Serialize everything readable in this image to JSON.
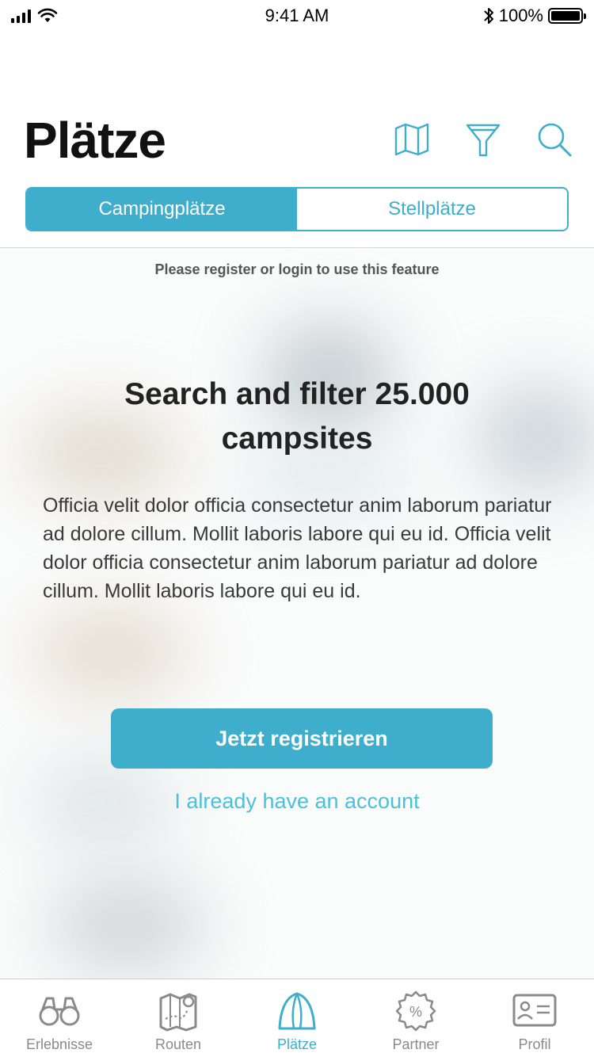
{
  "status_bar": {
    "time": "9:41 AM",
    "battery_percent": "100%",
    "battery_level": 1.0
  },
  "header": {
    "title": "Plätze",
    "icons": [
      "map-icon",
      "filter-icon",
      "search-icon"
    ]
  },
  "segments": {
    "items": [
      {
        "label": "Campingplätze",
        "active": true
      },
      {
        "label": "Stellplätze",
        "active": false
      }
    ]
  },
  "promo": {
    "hint": "Please register or login to use this feature",
    "title": "Search and filter 25.000 campsites",
    "body": "Officia velit dolor officia consectetur anim laborum pariatur ad dolore cillum. Mollit laboris labore qui eu id. Officia velit dolor officia consectetur anim laborum pariatur ad dolore cillum. Mollit laboris labore qui eu id.",
    "register_button": "Jetzt registrieren",
    "login_link": "I already have an account"
  },
  "tab_bar": {
    "items": [
      {
        "label": "Erlebnisse",
        "icon": "binoculars-icon",
        "active": false
      },
      {
        "label": "Routen",
        "icon": "route-map-icon",
        "active": false
      },
      {
        "label": "Plätze",
        "icon": "tent-icon",
        "active": true
      },
      {
        "label": "Partner",
        "icon": "discount-badge-icon",
        "active": false
      },
      {
        "label": "Profil",
        "icon": "id-card-icon",
        "active": false
      }
    ]
  },
  "colors": {
    "accent": "#3eaecc",
    "link": "#4cc0db",
    "inactive_tab": "#8a8a8a"
  }
}
